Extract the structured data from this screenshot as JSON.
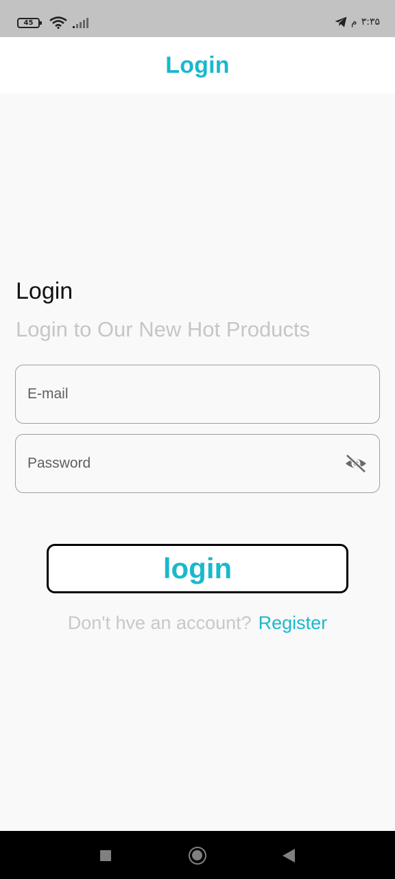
{
  "status_bar": {
    "battery_level": "45",
    "time": "۳:۳۵",
    "meridiem": "م",
    "icons": [
      "battery-icon",
      "wifi-icon",
      "signal-icon",
      "telegram-icon"
    ]
  },
  "app_bar": {
    "title": "Login"
  },
  "form": {
    "heading": "Login",
    "subheading": "Login to Our New Hot Products",
    "email_label": "E-mail",
    "password_label": "Password",
    "password_toggle_icon": "eye-off-icon",
    "submit_label": "login"
  },
  "footer": {
    "prompt": "Don't hve an account?",
    "register_label": "Register"
  },
  "nav": {
    "icons": [
      "recents-icon",
      "home-icon",
      "back-icon"
    ]
  },
  "colors": {
    "accent": "#1ab8cc",
    "status_bar": "#c2c2c2",
    "background": "#f9f9f9",
    "muted_text": "#c6c6c6"
  }
}
